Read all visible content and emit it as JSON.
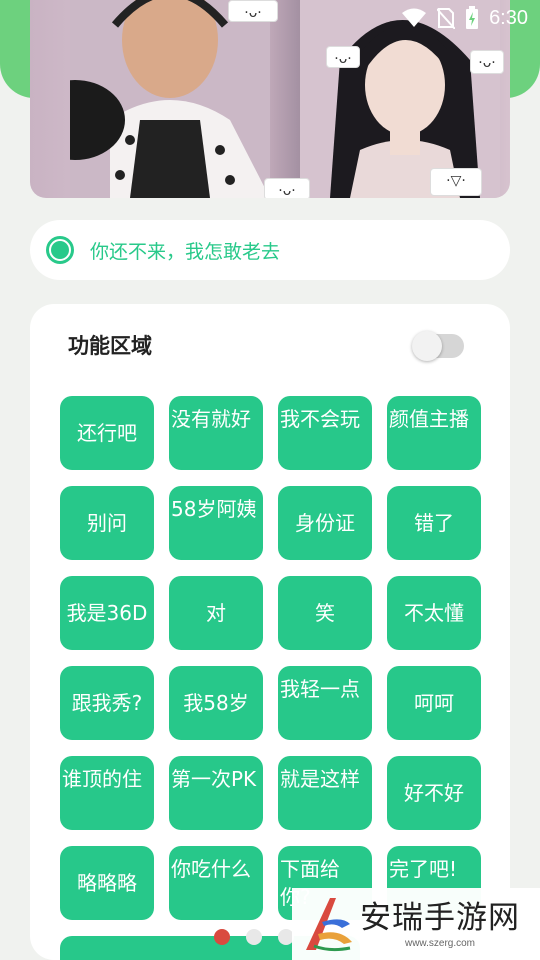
{
  "status_bar": {
    "time": "6:30",
    "icons": [
      "wifi-icon",
      "no-sim-icon",
      "battery-charging-icon"
    ]
  },
  "video": {
    "stickers": [
      "·ᴗ·",
      "·ᴗ·",
      "·▽·",
      "·ᴗ·",
      "·ᴗ·"
    ]
  },
  "message": {
    "text": "你还不来，我怎敢老去"
  },
  "panel": {
    "title": "功能区域",
    "toggle_on": false,
    "buttons": [
      "还行吧",
      "没有就好",
      "我不会玩",
      "颜值主播",
      "别问",
      "58岁阿姨",
      "身份证",
      "错了",
      "我是36D",
      "对",
      "笑",
      "不太懂",
      "跟我秀?",
      "我58岁",
      "我轻一点",
      "呵呵",
      "谁顶的住",
      "第一次PK",
      "就是这样",
      "好不好",
      "略略略",
      "你吃什么",
      "下面给你?",
      "完了吧!"
    ]
  },
  "pagination": {
    "count": 3,
    "active": 0
  },
  "watermark": {
    "title": "安瑞手游网",
    "url": "www.szerg.com"
  },
  "colors": {
    "accent": "#27c88a",
    "band": "#6dd17e",
    "dot_active": "#d94a3f"
  }
}
